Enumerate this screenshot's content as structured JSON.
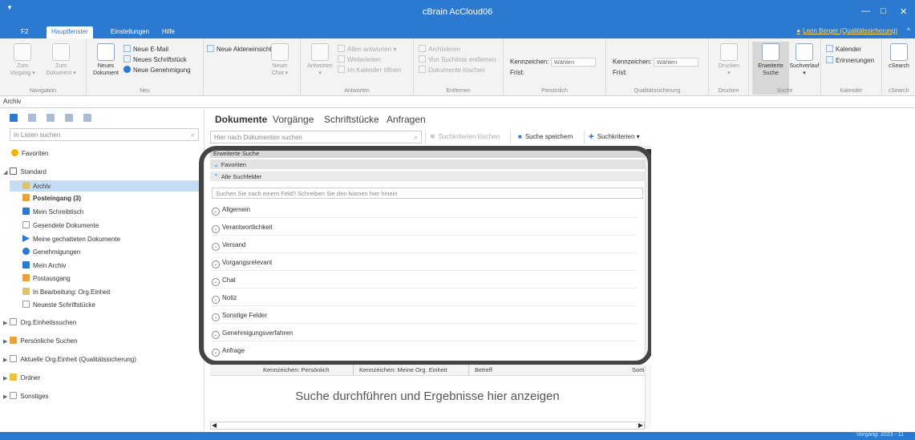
{
  "window": {
    "title": "cBrain AcCloud06"
  },
  "menu": {
    "tabs": [
      "F2",
      "Hauptfenster",
      "Einstellungen",
      "Hilfe"
    ],
    "user": "Leon Berger (Qualitätssicherung)"
  },
  "ribbon": {
    "navigation": {
      "label": "Navigation",
      "zum_vorgang": [
        "Zum",
        "Vorgang ▾"
      ],
      "zum_dokument": [
        "Zum",
        "Dokument ▾"
      ]
    },
    "neu": {
      "label": "Neu",
      "neues_dokument": [
        "Neues",
        "Dokument"
      ],
      "neue_email": "Neue E-Mail",
      "neues_schriftstueck": "Neues Schriftstück",
      "neue_genehmigung": "Neue Genehmigung",
      "neue_akteneinsicht": "Neue Akteneinsicht",
      "neuer_chat": [
        "Neuer",
        "Chat ▾"
      ]
    },
    "antworten": {
      "label": "Antworten",
      "antworten": [
        "Antworten",
        "▾"
      ],
      "allen_antworten": "Allen antworten ▾",
      "weiterleiten": "Weiterleiten",
      "im_kalender": "Im Kalender öffnen"
    },
    "entfernen": {
      "label": "Entfernen",
      "archivieren": "Archivieren",
      "von_suchliste": "Von Suchliste entfernen",
      "dokumente_loeschen": "Dokumente löschen"
    },
    "persoenlich": {
      "label": "Persönlich",
      "kennzeichen": "Kennzeichen:",
      "waehlen": "Wählen",
      "frist": "Frist:"
    },
    "qualitaet": {
      "label": "Qualitätssicherung",
      "kennzeichen": "Kennzeichen:",
      "waehlen": "Wählen",
      "frist": "Frist:"
    },
    "drucken": {
      "label": "Drucken",
      "btn": [
        "Drucken",
        "▾"
      ]
    },
    "suche": {
      "label": "Suche",
      "erweiterte": [
        "Erweiterte",
        "Suche"
      ],
      "suchverlauf": [
        "Suchverlauf",
        "▾"
      ]
    },
    "kalender": {
      "label": "Kalender",
      "kalender": "Kalender",
      "erinnerungen": "Erinnerungen"
    },
    "csearch": {
      "label": "cSearch",
      "btn": "cSearch"
    }
  },
  "doc_tab": "Archiv",
  "left": {
    "search_placeholder": "In Listen suchen",
    "items": [
      "Favoriten",
      "Standard",
      "Archiv",
      "Posteingang (3)",
      "Mein Schreibtisch",
      "Gesendete Dokumente",
      "Meine gechatteten Dokumente",
      "Genehmigungen",
      "Mein Archiv",
      "Postausgang",
      "In Bearbeitung: Org.Einheit",
      "Neueste Schriftstücke",
      "Org.Einheitssuchen",
      "Persönliche Suchen",
      "Aktuelle Org.Einheit (Qualitätssicherung)",
      "Ordner",
      "Sonstiges"
    ]
  },
  "center": {
    "tabs": [
      "Dokumente",
      "Vorgänge",
      "Schriftstücke",
      "Anfragen"
    ],
    "search_placeholder": "Hier nach Dokumenten suchen",
    "toolbar": {
      "clear": "Suchkriterien löschen",
      "save": "Suche speichern",
      "criteria": "Suchkriterien ▾"
    },
    "sections": {
      "advanced": "Erweiterte Suche",
      "favorites": "Favoriten",
      "all_fields": "Alle Suchfelder"
    },
    "field_search_placeholder": "Suchen Sie nach einem Feld? Schreiben Sie den Namen hier hinein",
    "groups": [
      "Allgemein",
      "Verantwortlichkeit",
      "Versand",
      "Vorgangsrelevant",
      "Chat",
      "Notiz",
      "Sonstige Felder",
      "Genehmigungsverfahren",
      "Anfrage"
    ],
    "columns": [
      "Kennzeichen: Persönlich",
      "Kennzeichen: Meine Org. Einheit",
      "Betreff",
      "Sorti"
    ],
    "empty_text": "Suche durchführen und Ergebnisse hier anzeigen"
  },
  "status": {
    "text": "Vorgang: 2023 - 11"
  },
  "colors": {
    "accent": "#2b79d0",
    "user_link": "#ffd966",
    "selection": "#c5ddf4"
  }
}
